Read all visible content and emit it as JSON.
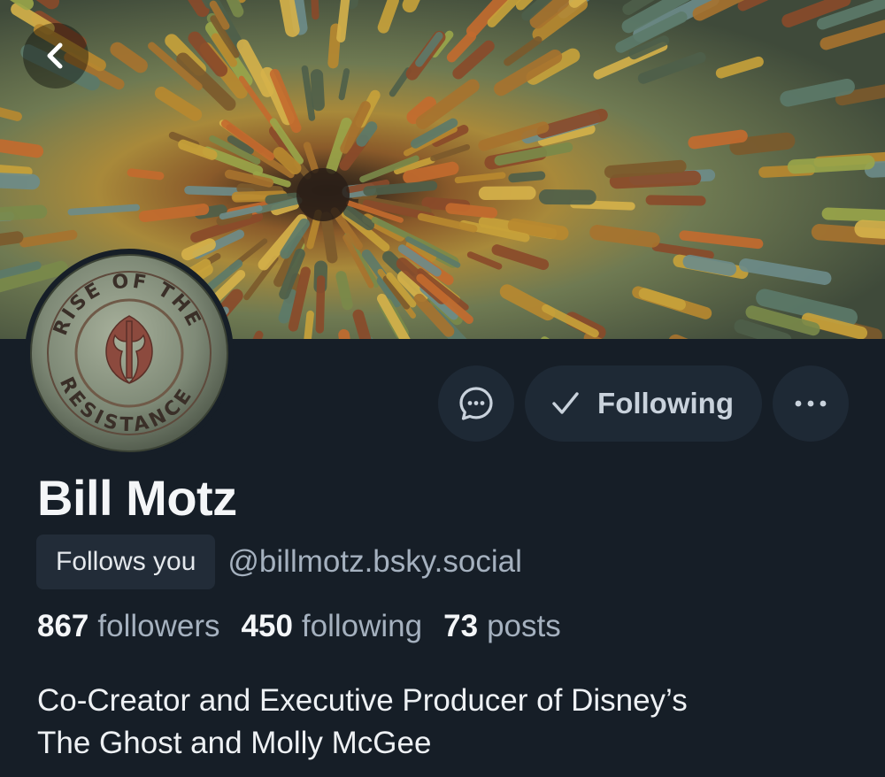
{
  "header": {
    "back_icon": "chevron-left-icon"
  },
  "avatar": {
    "ring_top_text": "RISE OF THE",
    "ring_bottom_text": "RESISTANCE"
  },
  "actions": {
    "message_icon": "chat-bubble-icon",
    "follow_label": "Following",
    "follow_icon": "check-icon",
    "more_icon": "ellipsis-icon"
  },
  "profile": {
    "display_name": "Bill Motz",
    "follows_you_label": "Follows you",
    "handle": "@billmotz.bsky.social"
  },
  "stats": [
    {
      "value": "867",
      "label": "followers"
    },
    {
      "value": "450",
      "label": "following"
    },
    {
      "value": "73",
      "label": "posts"
    }
  ],
  "bio": {
    "line1": "Co-Creator and Executive Producer of Disney’s",
    "line2": "The Ghost and Molly McGee"
  },
  "colors": {
    "background": "#161e27",
    "button_bg": "#1e2935",
    "muted_text": "#a5b1bf"
  }
}
